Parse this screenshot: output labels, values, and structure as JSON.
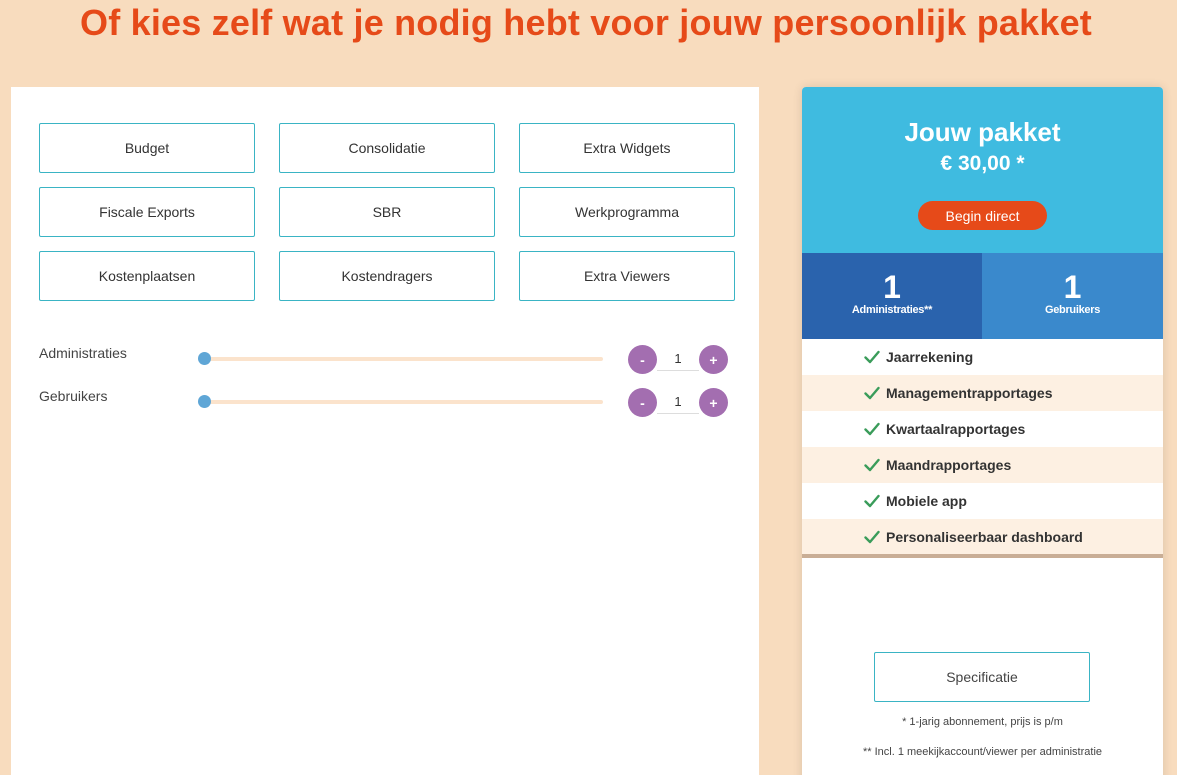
{
  "headline": "Of kies zelf wat je nodig hebt voor jouw persoonlijk pakket",
  "options": [
    "Budget",
    "Consolidatie",
    "Extra Widgets",
    "Fiscale Exports",
    "SBR",
    "Werkprogramma",
    "Kostenplaatsen",
    "Kostendragers",
    "Extra Viewers"
  ],
  "sliders": {
    "administraties": {
      "label": "Administraties",
      "value": "1",
      "minus": "-",
      "plus": "+"
    },
    "gebruikers": {
      "label": "Gebruikers",
      "value": "1",
      "minus": "-",
      "plus": "+"
    }
  },
  "card": {
    "title": "Jouw pakket",
    "price": "€ 30,00 *",
    "cta": "Begin direct",
    "admin_count": "1",
    "admin_label": "Administraties**",
    "users_count": "1",
    "users_label": "Gebruikers",
    "features": [
      "Jaarrekening",
      "Managementrapportages",
      "Kwartaalrapportages",
      "Maandrapportages",
      "Mobiele app",
      "Personaliseerbaar dashboard"
    ],
    "spec_button": "Specificatie",
    "note1": "* 1-jarig abonnement, prijs is p/m",
    "note2": "** Incl. 1 meekijkaccount/viewer per administratie"
  },
  "colors": {
    "background": "#f8dcbe",
    "accent": "#e64a19",
    "card_header": "#3fbbe0",
    "admin_box": "#2a63ad",
    "users_box": "#3a89cc",
    "stepper": "#a36eb0",
    "check": "#3a9c5a"
  }
}
